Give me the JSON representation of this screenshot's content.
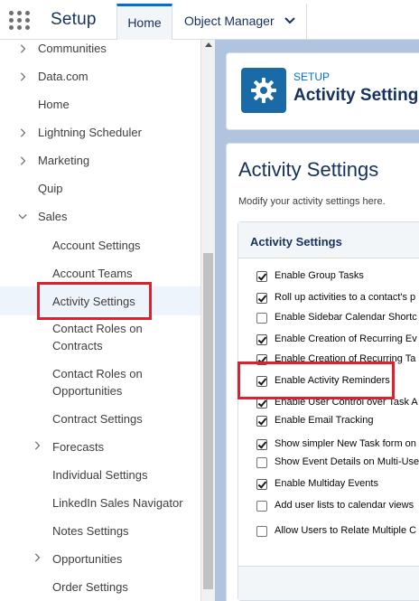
{
  "topbar": {
    "app_name": "Setup",
    "tabs": [
      {
        "label": "Home",
        "active": true
      },
      {
        "label": "Object Manager",
        "active": false
      }
    ]
  },
  "sidebar": {
    "items": [
      {
        "label": "Communities",
        "expandable": true,
        "expanded": false
      },
      {
        "label": "Data.com",
        "expandable": true,
        "expanded": false
      },
      {
        "label": "Home",
        "expandable": false
      },
      {
        "label": "Lightning Scheduler",
        "expandable": true,
        "expanded": false
      },
      {
        "label": "Marketing",
        "expandable": true,
        "expanded": false
      },
      {
        "label": "Quip",
        "expandable": false
      },
      {
        "label": "Sales",
        "expandable": true,
        "expanded": true
      }
    ],
    "sales_children": [
      {
        "label": "Account Settings"
      },
      {
        "label": "Account Teams"
      },
      {
        "label": "Activity Settings",
        "selected": true
      },
      {
        "label": "Contact Roles on Contracts"
      },
      {
        "label": "Contact Roles on Opportunities"
      },
      {
        "label": "Contract Settings"
      },
      {
        "label": "Forecasts",
        "expandable": true
      },
      {
        "label": "Individual Settings"
      },
      {
        "label": "LinkedIn Sales Navigator"
      },
      {
        "label": "Notes Settings"
      },
      {
        "label": "Opportunities",
        "expandable": true
      },
      {
        "label": "Order Settings"
      }
    ]
  },
  "header": {
    "breadcrumb": "SETUP",
    "title": "Activity Settings",
    "icon": "gear-icon"
  },
  "content": {
    "title": "Activity Settings",
    "description": "Modify your activity settings here.",
    "section_title": "Activity Settings",
    "options": [
      {
        "label": "Enable Group Tasks",
        "checked": true
      },
      {
        "label": "Roll up activities to a contact's p",
        "checked": true
      },
      {
        "label": "Enable Sidebar Calendar Shortc",
        "checked": false
      },
      {
        "label": "Enable Creation of Recurring Ev",
        "checked": true
      },
      {
        "label": "Enable Creation of Recurring Ta",
        "checked": true
      },
      {
        "label": "Enable Activity Reminders",
        "checked": true
      },
      {
        "label": "Enable User Control over Task A",
        "checked": true
      },
      {
        "label": "Enable Email Tracking",
        "checked": true
      },
      {
        "label": "Show simpler New Task form on",
        "checked": true
      },
      {
        "label": "Show Event Details on Multi-Use",
        "checked": false
      },
      {
        "label": "Enable Multiday Events",
        "checked": true
      },
      {
        "label": "Add user lists to calendar views",
        "checked": false
      },
      {
        "label": "Allow Users to Relate Multiple C",
        "checked": false
      }
    ]
  },
  "colors": {
    "accent": "#0070d2",
    "highlight": "#e0202d",
    "main_bg": "#b0c4df",
    "gear_tile": "#1a6aa8"
  }
}
